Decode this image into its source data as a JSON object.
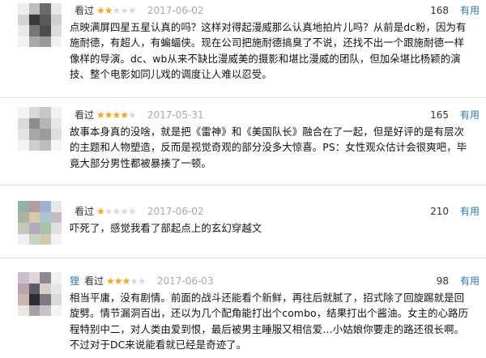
{
  "reviews": [
    {
      "user": "",
      "watched": "看过",
      "rating": 2,
      "max_rating": 5,
      "date": "2017-06-02",
      "votes": "168",
      "useful_label": "有用",
      "content": "点映满屏四星五星认真的吗？这样对得起漫威那么认真地拍片儿吗？从前是dc粉，因为有施耐德，有超人，有蝙蝠侠。现在公司把施耐德搞臭了不说，还找不出一个跟施耐德一样像样的导演。dc、wb从来不缺比漫威美的摄影和堪比漫威的团队，但加朵堪比杨颖的演技、整个电影如同儿戏的调度让人难以忍受。"
    },
    {
      "user": "",
      "watched": "看过",
      "rating": 4,
      "max_rating": 5,
      "date": "2017-05-31",
      "votes": "165",
      "useful_label": "有用",
      "content": "故事本身真的没啥，就是把《雷神》和《美国队长》融合在了一起，但是好评的是有层次的主题和人物塑造，反而是视觉奇观的部分没多大惊喜。PS：女性观众估计会很爽吧，毕竟大部分男性都被暴揍了一顿。"
    },
    {
      "user": "",
      "watched": "看过",
      "rating": 1,
      "max_rating": 5,
      "date": "2017-06-02",
      "votes": "210",
      "useful_label": "有用",
      "content": "吓死了，感觉我看了部起点上的玄幻穿越文"
    },
    {
      "user": "狸",
      "watched": "看过",
      "rating": 3,
      "max_rating": 5,
      "date": "2017-06-03",
      "votes": "98",
      "useful_label": "有用",
      "content": "相当平庸，没有剧情。前面的战斗还能看个新鲜，再往后就腻了，招式除了回旋踢就是回旋劈。情节漏洞百出，还以为几个配角能打出个combo，结果打出个酱油。女主的心路历程特别中二，对人类由爱到恨，最后被男主睡服又相信爱…小姑娘你要走的路还很长啊。不过对于DC来说能看就已经是奇迹了。"
    }
  ],
  "colors": {
    "link": "#3377aa",
    "star": "#f5a623",
    "date": "#aaaaaa",
    "text": "#111111"
  },
  "icons": [
    "avatar-image",
    "rating-stars"
  ]
}
